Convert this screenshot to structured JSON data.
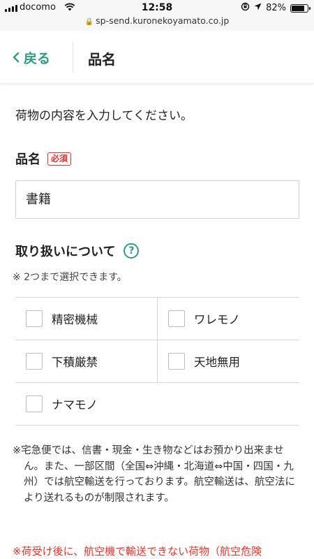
{
  "status_bar": {
    "carrier": "docomo",
    "time": "12:58",
    "battery": "82%",
    "battery_level": 0.82,
    "url": "sp-send.kuronekoyamato.co.jp"
  },
  "header": {
    "back_label": "戻る",
    "title": "品名"
  },
  "main": {
    "lead": "荷物の内容を入力してください。",
    "item_name": {
      "label": "品名",
      "required_badge": "必須",
      "value": "書籍"
    },
    "handling": {
      "label": "取り扱いについて",
      "help_icon": "?",
      "note": "※ 2つまで選択できます。",
      "options": [
        "精密機械",
        "ワレモノ",
        "下積厳禁",
        "天地無用",
        "ナマモノ"
      ]
    },
    "notice": "※宅急便では、信書・現金・生き物などはお預かり出来ません。また、一部区間（全国⇔沖縄・北海道⇔中国・四国・九州）では航空輸送を行っております。航空輸送は、航空法により送れるものが制限されます。",
    "notice_warning": "※荷受け後に、航空機で輸送できない荷物（航空危険"
  },
  "colors": {
    "accent": "#2f9b85",
    "required": "#e5342b"
  }
}
